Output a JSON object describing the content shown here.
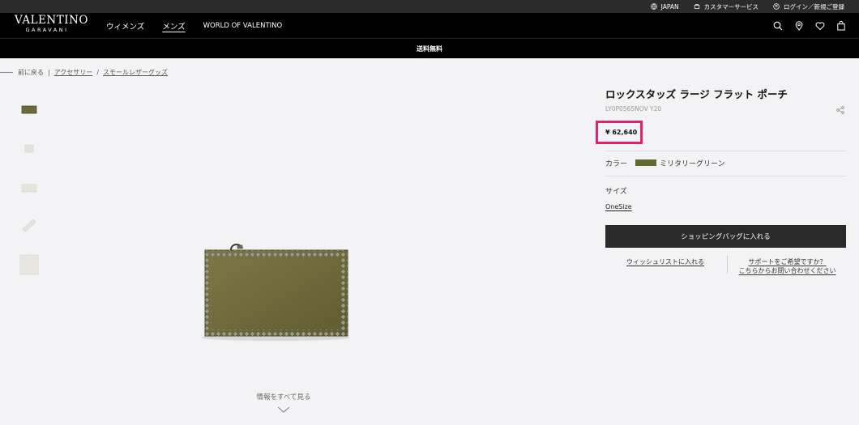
{
  "topbar": {
    "country": "JAPAN",
    "customer_service": "カスタマーサービス",
    "login": "ログイン／新規ご登録"
  },
  "nav": {
    "logo_line1": "VALENTINO",
    "logo_line2": "GARAVANI",
    "items": [
      "ウィメンズ",
      "メンズ",
      "WORLD OF VALENTINO"
    ],
    "active_item": "メンズ",
    "icons": [
      "search-icon",
      "location-pin-icon",
      "heart-icon",
      "shopping-bag-icon"
    ]
  },
  "promo": {
    "text": "送料無料"
  },
  "breadcrumb": {
    "back": "前に戻る",
    "crumbs": [
      "アクセサリー",
      "スモールレザーグッズ"
    ]
  },
  "gallery": {
    "see_all": "情報をすべて見る"
  },
  "product": {
    "title": "ロックスタッズ ラージ フラット ポーチ",
    "sku": "LY0P0565NOV Y20",
    "price": "¥ 62,640",
    "color_label": "カラー",
    "color_name": "ミリタリーグリーン",
    "size_label": "サイズ",
    "size_value": "OneSize",
    "cart_button": "ショッピングバッグに入れる",
    "wishlist_link": "ウィッシュリストに入れる",
    "support_line1": "サポートをご希望ですか？",
    "support_line2": "こちらからお問い合わせください"
  },
  "colors": {
    "accent_highlight": "#e6206f",
    "product_swatch": "#5e6a32",
    "nav_background": "#000000"
  }
}
